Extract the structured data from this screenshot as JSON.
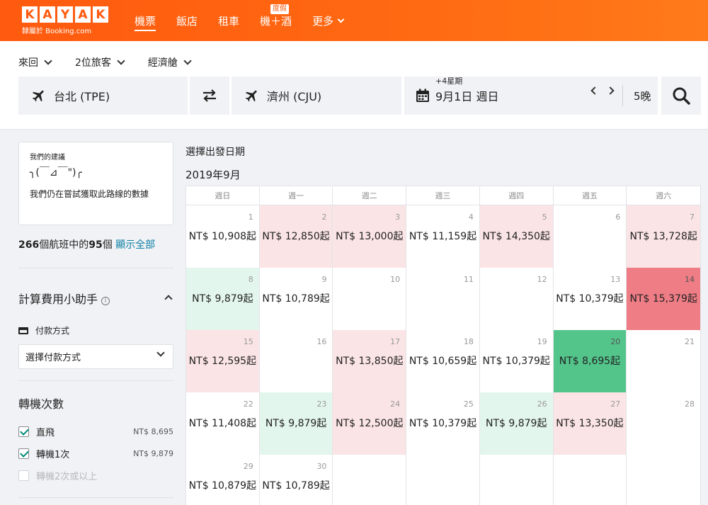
{
  "header": {
    "logo_letters": [
      "K",
      "A",
      "Y",
      "A",
      "K"
    ],
    "logo_sub": "隸屬於 Booking.com",
    "nav": [
      {
        "label": "機票",
        "active": true
      },
      {
        "label": "飯店"
      },
      {
        "label": "租車"
      },
      {
        "label": "機＋酒",
        "badge": "度假"
      },
      {
        "label": "更多"
      }
    ]
  },
  "search": {
    "trip_type": "來回",
    "travelers": "2位旅客",
    "cabin": "經濟艙",
    "origin": "台北 (TPE)",
    "destination": "濟州 (CJU)",
    "date_hint": "+4星期",
    "date": "9月1日 週日",
    "nights": "5晚"
  },
  "sidebar": {
    "rec_title": "我們的建議",
    "rec_face": "╮(￣⊿￣\")╭",
    "rec_msg": "我們仍在嘗試獲取此路線的數據",
    "count_total": "266",
    "count_mid": "個航班中的",
    "count_shown": "95",
    "count_unit": "個",
    "show_all": "顯示全部",
    "fee_title": "計算費用小助手",
    "pay_label": "付款方式",
    "pay_select": "選擇付款方式",
    "stops_title": "轉機次數",
    "stops": [
      {
        "label": "直飛",
        "price": "NT$ 8,695",
        "checked": true
      },
      {
        "label": "轉機1次",
        "price": "NT$ 9,879",
        "checked": true
      },
      {
        "label": "轉機2次或以上",
        "price": "",
        "checked": false,
        "disabled": true
      }
    ]
  },
  "calendar": {
    "title": "選擇出發日期",
    "month": "2019年9月",
    "weekdays": [
      "週日",
      "週一",
      "週二",
      "週三",
      "週四",
      "週五",
      "週六"
    ],
    "weeks": [
      [
        {
          "day": "1",
          "price": "NT$ 10,908起",
          "tone": ""
        },
        {
          "day": "2",
          "price": "NT$ 12,850起",
          "tone": "red"
        },
        {
          "day": "3",
          "price": "NT$ 13,000起",
          "tone": "red"
        },
        {
          "day": "4",
          "price": "NT$ 11,159起",
          "tone": ""
        },
        {
          "day": "5",
          "price": "NT$ 14,350起",
          "tone": "red"
        },
        {
          "day": "6",
          "price": "",
          "tone": ""
        },
        {
          "day": "7",
          "price": "NT$ 13,728起",
          "tone": "red"
        }
      ],
      [
        {
          "day": "8",
          "price": "NT$ 9,879起",
          "tone": "green"
        },
        {
          "day": "9",
          "price": "NT$ 10,789起",
          "tone": ""
        },
        {
          "day": "10",
          "price": "",
          "tone": ""
        },
        {
          "day": "11",
          "price": "",
          "tone": ""
        },
        {
          "day": "12",
          "price": "",
          "tone": ""
        },
        {
          "day": "13",
          "price": "NT$ 10,379起",
          "tone": ""
        },
        {
          "day": "14",
          "price": "NT$ 15,379起",
          "tone": "redstrong"
        }
      ],
      [
        {
          "day": "15",
          "price": "NT$ 12,595起",
          "tone": "red"
        },
        {
          "day": "16",
          "price": "",
          "tone": ""
        },
        {
          "day": "17",
          "price": "NT$ 13,850起",
          "tone": "red"
        },
        {
          "day": "18",
          "price": "NT$ 10,659起",
          "tone": ""
        },
        {
          "day": "19",
          "price": "NT$ 10,379起",
          "tone": ""
        },
        {
          "day": "20",
          "price": "NT$ 8,695起",
          "tone": "greenstrong"
        },
        {
          "day": "21",
          "price": "",
          "tone": ""
        }
      ],
      [
        {
          "day": "22",
          "price": "NT$ 11,408起",
          "tone": ""
        },
        {
          "day": "23",
          "price": "NT$ 9,879起",
          "tone": "green"
        },
        {
          "day": "24",
          "price": "NT$ 12,500起",
          "tone": "red"
        },
        {
          "day": "25",
          "price": "NT$ 10,379起",
          "tone": ""
        },
        {
          "day": "26",
          "price": "NT$ 9,879起",
          "tone": "green"
        },
        {
          "day": "27",
          "price": "NT$ 13,350起",
          "tone": "red"
        },
        {
          "day": "28",
          "price": "",
          "tone": ""
        }
      ],
      [
        {
          "day": "29",
          "price": "NT$ 10,879起",
          "tone": ""
        },
        {
          "day": "30",
          "price": "NT$ 10,789起",
          "tone": ""
        },
        {
          "day": "",
          "price": "",
          "tone": ""
        },
        {
          "day": "",
          "price": "",
          "tone": ""
        },
        {
          "day": "",
          "price": "",
          "tone": ""
        },
        {
          "day": "",
          "price": "",
          "tone": ""
        },
        {
          "day": "",
          "price": "",
          "tone": ""
        }
      ]
    ]
  },
  "colors": {
    "brand": "#ff5a0f",
    "price_high": "#fbe4e5",
    "price_highest": "#ee7d85",
    "price_low": "#e3f6ed",
    "price_lowest": "#53c58b",
    "link": "#0a7ea4"
  }
}
